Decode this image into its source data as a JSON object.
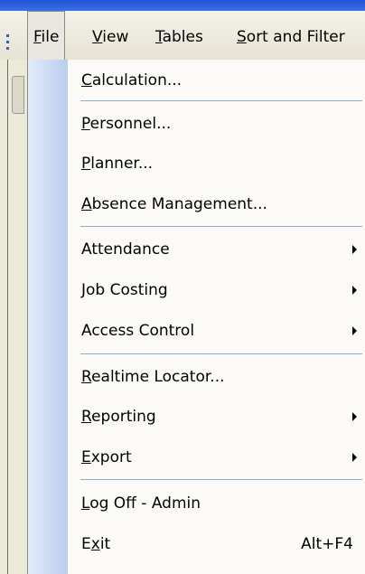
{
  "menubar": {
    "items": [
      {
        "mnemonic": "F",
        "rest": "ile",
        "active": true
      },
      {
        "mnemonic": "V",
        "rest": "iew"
      },
      {
        "mnemonic": "T",
        "rest": "ables"
      },
      {
        "mnemonic": "S",
        "rest": "ort and Filter"
      }
    ]
  },
  "file_menu": {
    "items": [
      {
        "mn": "C",
        "rest": "alculation..."
      },
      {
        "mn": "P",
        "rest": "ersonnel..."
      },
      {
        "mn": "P",
        "rest": "lanner..."
      },
      {
        "mn": "A",
        "rest": "bsence Management..."
      },
      {
        "label": "Attendance"
      },
      {
        "label": "Job Costing"
      },
      {
        "label": "Access Control"
      },
      {
        "mn": "R",
        "rest": "ealtime Locator..."
      },
      {
        "mn": "R",
        "rest": "eporting"
      },
      {
        "mn": "E",
        "rest": "xport"
      },
      {
        "mn": "L",
        "rest": "og Off - Admin"
      },
      {
        "pre": "E",
        "mn": "x",
        "rest": "it",
        "shortcut": "Alt+F4"
      }
    ]
  },
  "colors": {
    "accent": "#1f55d6",
    "gutter_light": "#e3ecf9",
    "gutter_dark": "#b9cdee",
    "separator": "#8fa8d6"
  }
}
